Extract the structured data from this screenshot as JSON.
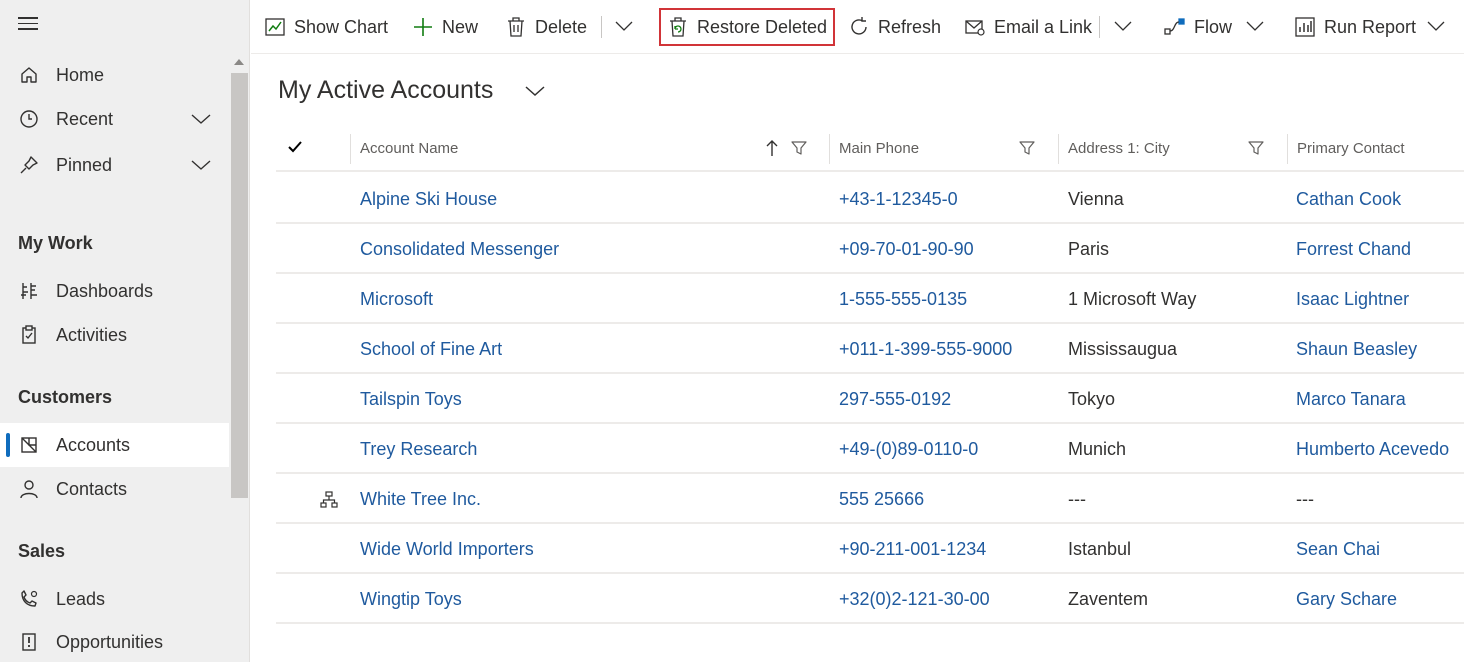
{
  "sidebar": {
    "items": [
      {
        "label": "Home",
        "icon": "home-icon"
      },
      {
        "label": "Recent",
        "icon": "clock-icon"
      },
      {
        "label": "Pinned",
        "icon": "pin-icon"
      }
    ],
    "groups": [
      {
        "title": "My Work",
        "items": [
          {
            "label": "Dashboards",
            "icon": "dashboard-icon"
          },
          {
            "label": "Activities",
            "icon": "clipboard-icon"
          }
        ]
      },
      {
        "title": "Customers",
        "items": [
          {
            "label": "Accounts",
            "icon": "accounts-icon",
            "active": true
          },
          {
            "label": "Contacts",
            "icon": "person-icon"
          }
        ]
      },
      {
        "title": "Sales",
        "items": [
          {
            "label": "Leads",
            "icon": "phone-person-icon"
          },
          {
            "label": "Opportunities",
            "icon": "opportunity-icon"
          }
        ]
      }
    ]
  },
  "toolbar": {
    "show_chart": "Show Chart",
    "new": "New",
    "delete": "Delete",
    "restore_deleted": "Restore Deleted",
    "refresh": "Refresh",
    "email_link": "Email a Link",
    "flow": "Flow",
    "run_report": "Run Report"
  },
  "view": {
    "title": "My Active Accounts"
  },
  "grid": {
    "columns": [
      "Account Name",
      "Main Phone",
      "Address 1: City",
      "Primary Contact"
    ],
    "rows": [
      {
        "name": "Alpine Ski House",
        "phone": "+43-1-12345-0",
        "city": "Vienna",
        "contact": "Cathan Cook",
        "hierarchy": false
      },
      {
        "name": "Consolidated Messenger",
        "phone": "+09-70-01-90-90",
        "city": "Paris",
        "contact": "Forrest Chand",
        "hierarchy": false
      },
      {
        "name": "Microsoft",
        "phone": "1-555-555-0135",
        "city": "1 Microsoft Way",
        "contact": "Isaac Lightner",
        "hierarchy": false
      },
      {
        "name": "School of Fine Art",
        "phone": "+011-1-399-555-9000",
        "city": "Mississaugua",
        "contact": "Shaun Beasley",
        "hierarchy": false
      },
      {
        "name": "Tailspin Toys",
        "phone": "297-555-0192",
        "city": "Tokyo",
        "contact": "Marco Tanara",
        "hierarchy": false
      },
      {
        "name": "Trey Research",
        "phone": "+49-(0)89-0110-0",
        "city": "Munich",
        "contact": "Humberto Acevedo",
        "hierarchy": false
      },
      {
        "name": "White Tree Inc.",
        "phone": "555 25666",
        "city": "---",
        "contact": "---",
        "hierarchy": true
      },
      {
        "name": "Wide World Importers",
        "phone": "+90-211-001-1234",
        "city": "Istanbul",
        "contact": "Sean Chai",
        "hierarchy": false
      },
      {
        "name": "Wingtip Toys",
        "phone": "+32(0)2-121-30-00",
        "city": "Zaventem",
        "contact": "Gary Schare",
        "hierarchy": false
      }
    ]
  },
  "colors": {
    "link": "#1f5a9e",
    "accent": "#0f6cbd",
    "highlight_border": "#d13438",
    "new_icon": "#107c10"
  }
}
